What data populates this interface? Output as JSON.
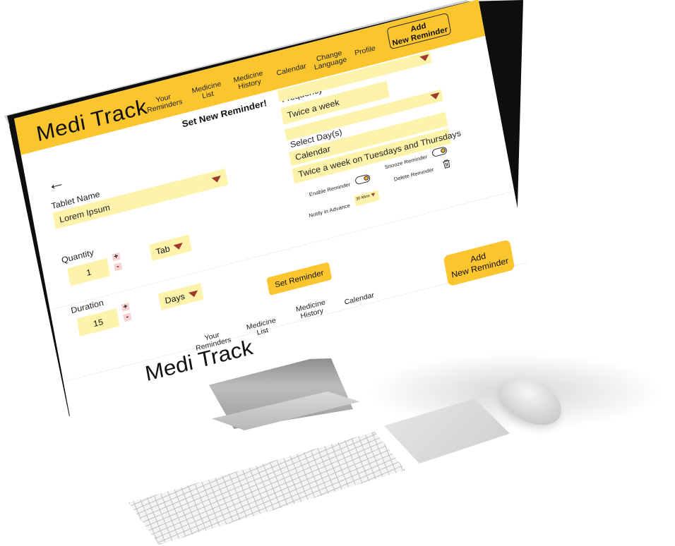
{
  "app": {
    "brand": "Medi Track"
  },
  "header": {
    "nav": [
      {
        "label": "Your\nReminders"
      },
      {
        "label": "Medicine\nList"
      },
      {
        "label": "Medicine\nHistory"
      },
      {
        "label": "Calendar"
      },
      {
        "label": "Change\nLanguage"
      },
      {
        "label": "Profile"
      }
    ],
    "add_button": "Add\nNew Reminder"
  },
  "form": {
    "title": "Set New Reminder!",
    "back_icon": "arrow-left-icon",
    "tablet_name": {
      "label": "Tablet Name",
      "value": "Lorem Ipsum"
    },
    "quantity": {
      "label": "Quantity",
      "value": "1",
      "unit": "Tab",
      "plus": "+",
      "minus": "-"
    },
    "duration": {
      "label": "Duration",
      "value": "15",
      "unit": "Days",
      "plus": "+",
      "minus": "-"
    },
    "frequency": {
      "label": "Frequency",
      "value": "Twice a week"
    },
    "select_days": {
      "label": "Select Day(s)",
      "value": "Calendar",
      "summary": "Twice a week on Tuesdays and Thursdays"
    },
    "enable_reminder": {
      "label": "Enable Reminder",
      "on": true
    },
    "snooze_reminder": {
      "label": "Snooze Reminder",
      "on": true
    },
    "delete_reminder": {
      "label": "Delete Reminder",
      "icon": "trash-icon"
    },
    "notify_in_advance": {
      "label": "Notify in Advance",
      "value": "30 Mins"
    },
    "set_button": "Set Reminder"
  },
  "footer": {
    "nav": [
      {
        "label": "Your\nReminders"
      },
      {
        "label": "Medicine\nList"
      },
      {
        "label": "Medicine\nHistory"
      },
      {
        "label": "Calendar"
      }
    ],
    "add_button": "Add\nNew Reminder",
    "brand": "Medi Track"
  },
  "colors": {
    "accent": "#fbc52d",
    "field": "#fdf3ab",
    "caret": "#a03a2a"
  }
}
